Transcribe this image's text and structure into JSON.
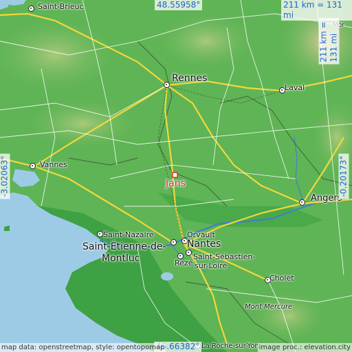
{
  "map": {
    "coords": {
      "top": "48.55958°",
      "bottom": "46.66382°",
      "left": "-3.02063°",
      "right": "-0.20173°",
      "scale_top": "211 km = 131 mi",
      "scale_right": "211 km = 131 mi"
    },
    "marker": {
      "label": "Jans",
      "color": "#e03030"
    },
    "places": {
      "saint_brieuc": "Saint-Brieuc",
      "rennes": "Rennes",
      "laval": "Laval",
      "vannes": "Vannes",
      "angers": "Angers",
      "saint_nazaire": "Saint-Nazaire",
      "orvault": "Orvault",
      "nantes": "Nantes",
      "saint_etienne": "Saint-Étienne-de-",
      "montluc": "Montluc",
      "saint_sebastien_1": "Saint-Sébastien-",
      "saint_sebastien_2": "sur-Loire",
      "reze": "Rezé",
      "cholet": "Cholet",
      "mont_mercure": "Mont Mercure",
      "la_roche": "La Roche-sur-Yon",
      "partial_top_right": "Mor"
    },
    "credits": {
      "left": "map data: openstreetmap, style: opentopomap",
      "right": "image proc.: elevation.city"
    },
    "colors": {
      "sea": "#9dcbe6",
      "land": "#5fb455",
      "coast_land": "#3ea144",
      "highland": "#b8c98a"
    }
  }
}
